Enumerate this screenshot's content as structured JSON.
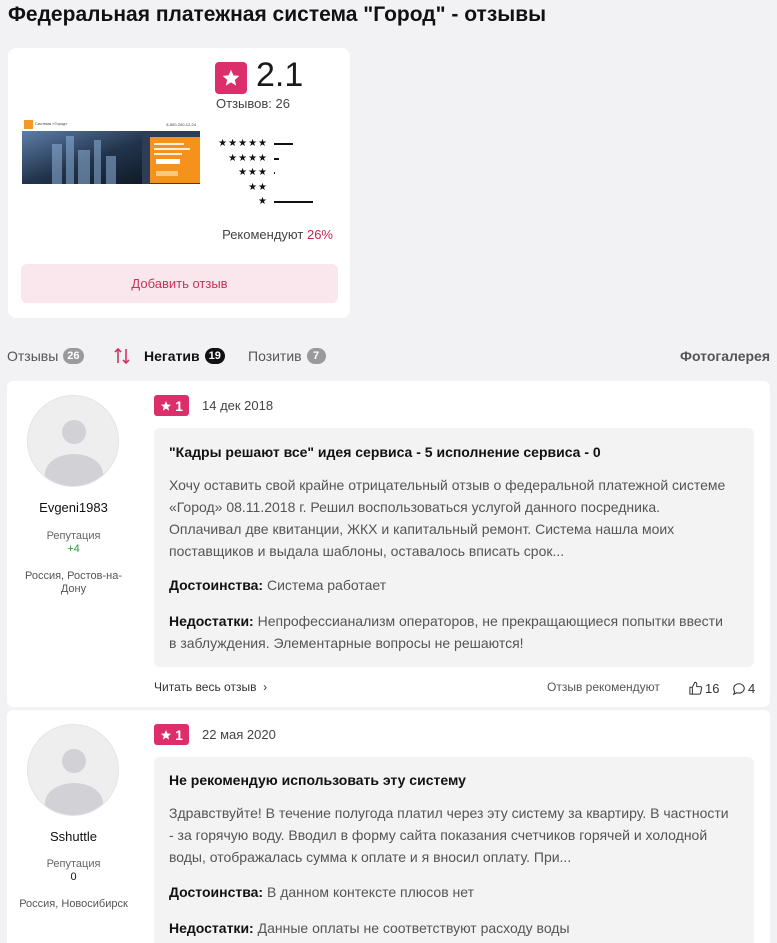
{
  "page": {
    "title": "Федеральная платежная система \"Город\" - отзывы"
  },
  "summary": {
    "rating": "2.1",
    "reviews_count": "Отзывов: 26",
    "distribution": [
      {
        "stars": "★★★★★",
        "fraction": 0.29
      },
      {
        "stars": "★★★★",
        "fraction": 0.08
      },
      {
        "stars": "★★★",
        "fraction": 0.02
      },
      {
        "stars": "★★",
        "fraction": 0.0
      },
      {
        "stars": "★",
        "fraction": 0.61
      }
    ],
    "recommend_label": "Рекомендуют",
    "recommend_pct": "26%",
    "add_review_label": "Добавить отзыв",
    "thumbnail": {
      "logo_text": "Система «Город»",
      "phone": "8-800-200-12-24"
    }
  },
  "tabs": {
    "all": {
      "label": "Отзывы",
      "count": "26"
    },
    "negative": {
      "label": "Негатив",
      "count": "19"
    },
    "positive": {
      "label": "Позитив",
      "count": "7"
    },
    "gallery_label": "Фотогалерея"
  },
  "reviews": [
    {
      "username": "Evgeni1983",
      "rep_label": "Репутация",
      "rep_value": "+4",
      "location": "Россия, Ростов-на-Дону",
      "rating": "1",
      "date": "14 дек 2018",
      "title": "\"Кадры решают все\" идея сервиса - 5 исполнение сервиса - 0",
      "text": "Хочу оставить свой крайне отрицательный отзыв о федеральной платежной системе «Город» 08.11.2018 г. Решил воспользоваться услугой данного посредника. Оплачивал две квитанции, ЖКХ и капитальный ремонт. Система нашла моих поставщиков и выдала шаблоны, оставалось вписать срок...",
      "pros_label": "Достоинства:",
      "pros": "Система работает",
      "cons_label": "Недостатки:",
      "cons": "Непрофессианализм операторов, не прекращающиеся попытки ввести в заблуждения. Элементарные вопросы не решаются!",
      "read_more": "Читать весь отзыв",
      "recommended": "Отзыв рекомендуют",
      "likes": "16",
      "comments": "4",
      "rep_color": "#2a9a3e"
    },
    {
      "username": "Sshuttle",
      "rep_label": "Репутация",
      "rep_value": "0",
      "location": "Россия, Новосибирск",
      "rating": "1",
      "date": "22 мая 2020",
      "title": "Не рекомендую использовать эту систему",
      "text": "Здравствуйте! В течение полугода платил через эту систему за квартиру. В частности - за горячую воду. Вводил в форму сайта показания счетчиков горячей и холодной воды, отображалась сумма к оплате и я вносил оплату. При...",
      "pros_label": "Достоинства:",
      "pros": "В данном контексте плюсов нет",
      "cons_label": "Недостатки:",
      "cons": "Данные оплаты не соответствуют расходу воды",
      "rep_color": "#111111"
    }
  ],
  "colors": {
    "accent": "#dc2e6a",
    "accent_text": "#c7325a",
    "button_bg": "#fae7ed",
    "background": "#f2f2f4"
  }
}
